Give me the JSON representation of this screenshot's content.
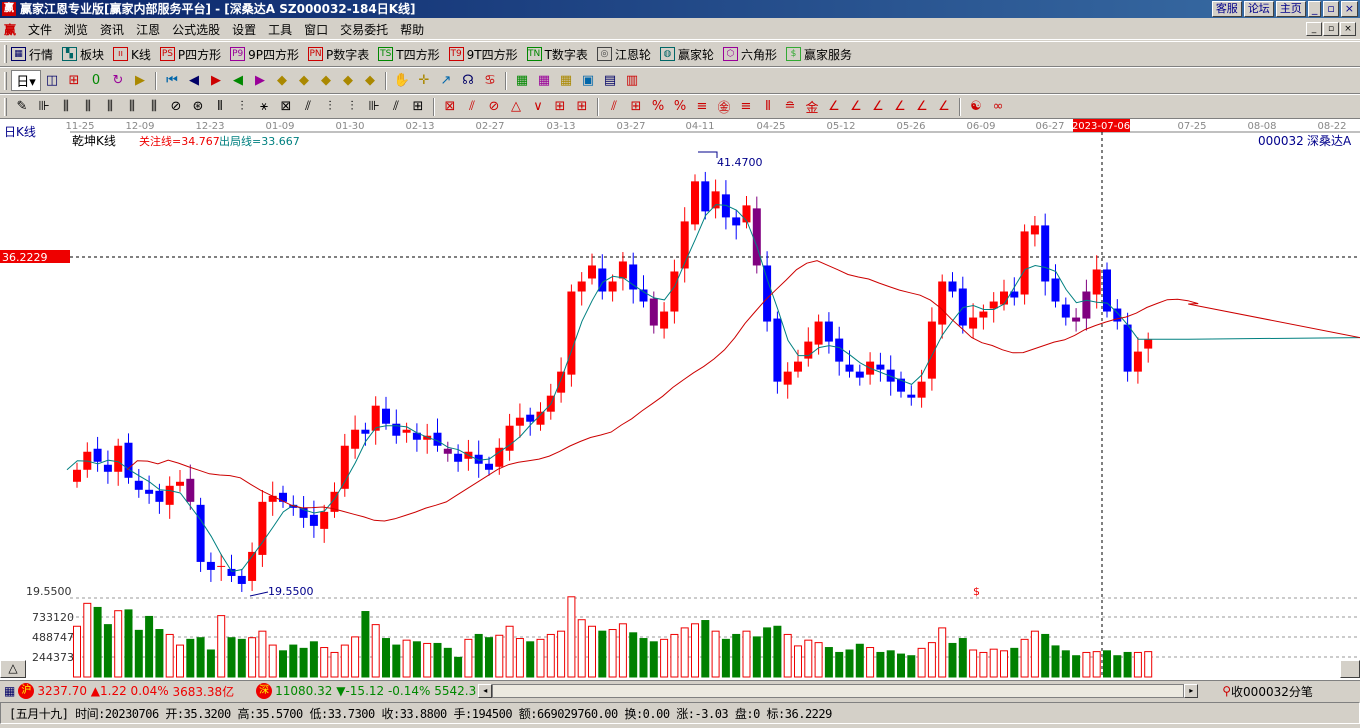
{
  "window": {
    "title": "赢家江恩专业版[赢家内部服务平台] - [深桑达A   SZ000032-184日K线]",
    "logo": "赢",
    "links": [
      "客服",
      "论坛",
      "主页"
    ],
    "controls": [
      "_",
      "▫",
      "×"
    ]
  },
  "menu": {
    "logo": "赢",
    "items": [
      "文件",
      "浏览",
      "资讯",
      "江恩",
      "公式选股",
      "设置",
      "工具",
      "窗口",
      "交易委托",
      "帮助"
    ]
  },
  "toolbar1": [
    {
      "icon": "grid-icon",
      "badge": "▦",
      "label": "行情",
      "color": "#006"
    },
    {
      "icon": "blocks-icon",
      "badge": "▚",
      "label": "板块",
      "color": "#066"
    },
    {
      "icon": "kline-icon",
      "badge": "ıı",
      "label": "K线",
      "color": "#c00"
    },
    {
      "icon": "ps-icon",
      "badge": "PS",
      "label": "P四方形",
      "color": "#c00"
    },
    {
      "icon": "p9-icon",
      "badge": "P9",
      "label": "9P四方形",
      "color": "#909"
    },
    {
      "icon": "pn-icon",
      "badge": "PN",
      "label": "P数字表",
      "color": "#c00"
    },
    {
      "icon": "ts-icon",
      "badge": "TS",
      "label": "T四方形",
      "color": "#080"
    },
    {
      "icon": "t9-icon",
      "badge": "T9",
      "label": "9T四方形",
      "color": "#c00"
    },
    {
      "icon": "tn-icon",
      "badge": "TN",
      "label": "T数字表",
      "color": "#080"
    },
    {
      "icon": "wheel-icon",
      "badge": "◎",
      "label": "江恩轮",
      "color": "#444"
    },
    {
      "icon": "big-wheel-icon",
      "badge": "◍",
      "label": "赢家轮",
      "color": "#066"
    },
    {
      "icon": "hexagon-icon",
      "badge": "⬡",
      "label": "六角形",
      "color": "#909"
    },
    {
      "icon": "dollar-icon",
      "badge": "$",
      "label": "赢家服务",
      "color": "#3a3"
    }
  ],
  "toolbar2": {
    "period": "日",
    "glyphs": [
      "◫",
      "⊞",
      "0",
      "↻",
      "▶",
      "⏮",
      "◀",
      "▶",
      "◀",
      "▶",
      "◆",
      "◆",
      "◆",
      "◆",
      "◆",
      "✋",
      "✛",
      "↗",
      "☊",
      "♋",
      "▦",
      "▦",
      "▦",
      "▣",
      "▤",
      "▥"
    ]
  },
  "toolbar3": {
    "glyphs": [
      "✎",
      "⊪",
      "⫼",
      "⫼",
      "⫼",
      "⫼",
      "⫼",
      "⊘",
      "⊛",
      "⫴",
      "⫶",
      "⚹",
      "⊠",
      "⫽",
      "⫶",
      "⫶",
      "⊪",
      "⫽",
      "⊞",
      "⊠",
      "⫽",
      "⊘",
      "△",
      "∨",
      "⊞",
      "⊞",
      "⫽",
      "⊞",
      "%",
      "%",
      "≡",
      "㊎",
      "≡",
      "⫴",
      "≘",
      "金",
      "∠",
      "∠",
      "∠",
      "∠",
      "∠",
      "∠",
      "☯",
      "∞"
    ]
  },
  "chart": {
    "period_label": "日K线",
    "indicator": "乾坤K线",
    "watch_line": "关注线=34.767",
    "exit_line": "出局线=33.667",
    "symbol": "000032",
    "name": "深桑达A",
    "date_ticks": [
      "11-25",
      "12-09",
      "12-23",
      "01-09",
      "01-30",
      "02-13",
      "02-27",
      "03-13",
      "03-27",
      "04-11",
      "04-25",
      "05-12",
      "05-26",
      "06-09",
      "06-27",
      "2023-07-06",
      "07-25",
      "08-08",
      "08-22"
    ],
    "cursor_price": "36.2229",
    "low_axis": "19.5500",
    "high_mark": "41.4700",
    "low_mark": "19.5500",
    "dollar_mark": "$",
    "volume_ticks": [
      "733120",
      "488747",
      "244373"
    ],
    "scroll_arrow": "△"
  },
  "chart_data": {
    "type": "candlestick",
    "price_range": [
      19.55,
      41.47
    ],
    "highlight_indices": [
      11,
      36,
      56,
      66,
      97,
      98
    ],
    "selected_index": 99,
    "closes": [
      25.6,
      26.5,
      26.0,
      25.5,
      26.8,
      25.2,
      24.6,
      24.4,
      24.0,
      24.8,
      25.0,
      24.0,
      21.0,
      20.6,
      20.8,
      20.3,
      19.9,
      21.5,
      24.0,
      24.3,
      24.0,
      23.7,
      23.2,
      22.8,
      23.5,
      24.5,
      26.8,
      27.6,
      27.4,
      28.8,
      27.9,
      27.3,
      27.6,
      27.1,
      27.3,
      26.8,
      26.4,
      26.0,
      26.5,
      25.9,
      25.6,
      26.7,
      27.8,
      28.2,
      28.0,
      28.5,
      29.3,
      30.5,
      34.5,
      35.0,
      35.8,
      34.5,
      35.0,
      36.0,
      34.6,
      34.0,
      32.8,
      33.5,
      35.5,
      38.0,
      40.0,
      38.5,
      39.5,
      38.2,
      37.8,
      38.8,
      35.8,
      33.0,
      30.0,
      30.5,
      31.0,
      32.0,
      33.0,
      32.0,
      31.0,
      30.5,
      30.2,
      31.0,
      30.6,
      30.0,
      29.5,
      29.2,
      30.0,
      33.0,
      35.0,
      34.5,
      32.8,
      33.2,
      33.5,
      34.0,
      34.5,
      34.2,
      37.5,
      37.8,
      35.0,
      34.0,
      33.2,
      33.0,
      34.5,
      35.6,
      33.5,
      33.0,
      30.5,
      31.5,
      32.1
    ],
    "volumes": [
      620000,
      900000,
      850000,
      640000,
      810000,
      820000,
      570000,
      740000,
      580000,
      520000,
      390000,
      460000,
      480000,
      330000,
      750000,
      480000,
      460000,
      480000,
      560000,
      390000,
      320000,
      390000,
      350000,
      430000,
      360000,
      300000,
      390000,
      490000,
      800000,
      640000,
      470000,
      390000,
      450000,
      430000,
      410000,
      410000,
      350000,
      240000,
      460000,
      520000,
      480000,
      510000,
      620000,
      470000,
      430000,
      460000,
      520000,
      560000,
      980000,
      700000,
      620000,
      560000,
      580000,
      650000,
      540000,
      470000,
      430000,
      460000,
      520000,
      600000,
      650000,
      690000,
      560000,
      460000,
      520000,
      560000,
      490000,
      600000,
      620000,
      520000,
      380000,
      450000,
      420000,
      360000,
      300000,
      330000,
      400000,
      360000,
      300000,
      320000,
      280000,
      260000,
      350000,
      420000,
      600000,
      410000,
      470000,
      330000,
      300000,
      340000,
      320000,
      350000,
      460000,
      560000,
      520000,
      380000,
      320000,
      260000,
      300000,
      310000,
      320000,
      260000,
      300000,
      300000,
      310000
    ]
  },
  "status": {
    "sh_badge": "沪",
    "sh_index": "3237.70",
    "sh_change": "▲1.22 0.04%",
    "sh_amount": "3683.38亿",
    "sz_badge": "深",
    "sz_index": "11080.32",
    "sz_change": "▼-15.12 -0.14%",
    "sz_amount": "5542.3",
    "receive": "收000032分笔",
    "detail": "[五月十九] 时间:20230706 开:35.3200 高:35.5700 低:33.7300 收:33.8800 手:194500 额:669029760.00 换:0.00 涨:-3.03 盘:0 标:36.2229"
  },
  "colors": {
    "up": "#ff0000",
    "down": "#0000ff",
    "special": "#800080",
    "vol_down": "#008000",
    "ma_fast": "#008080",
    "ma_slow": "#cc0000"
  }
}
